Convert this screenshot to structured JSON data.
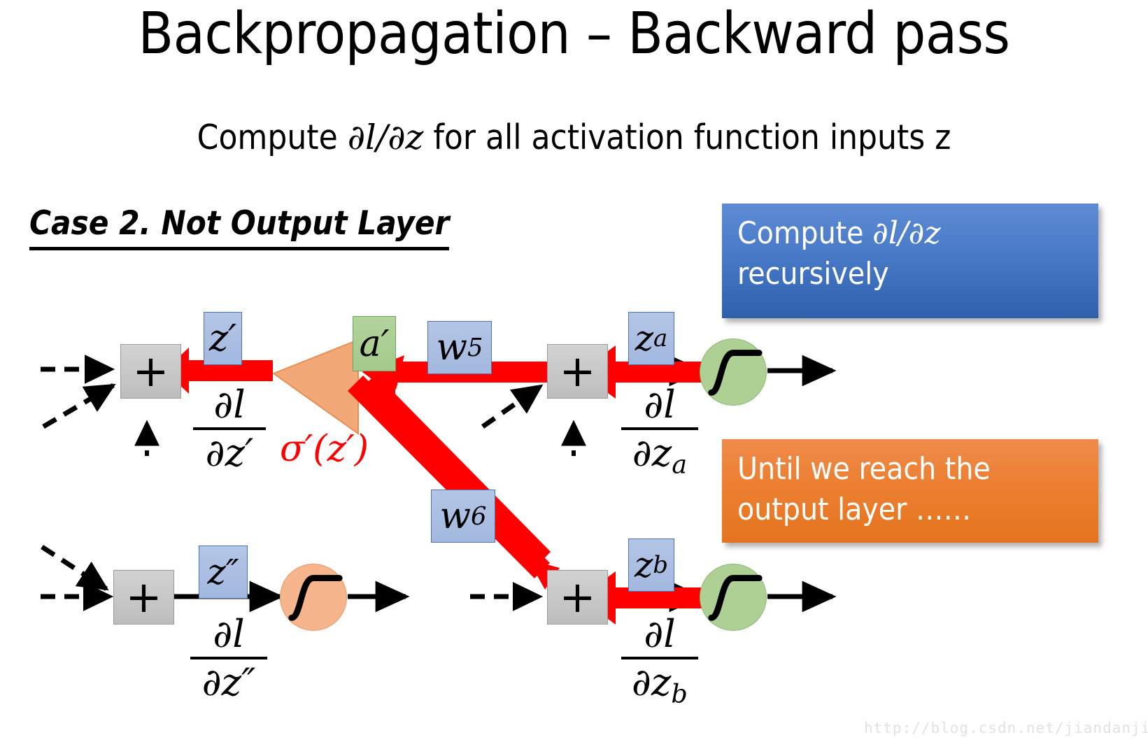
{
  "slide": {
    "title": "Backpropagation – Backward pass",
    "subtitle_pre": "Compute ",
    "subtitle_math": "∂l/∂z",
    "subtitle_post": " for all activation function inputs z",
    "case_heading": "Case 2. Not Output Layer",
    "watermark": "http://blog.csdn.net/jiandanjinxin"
  },
  "callouts": [
    {
      "id": "compute-recursively",
      "line1_pre": "Compute ",
      "line1_math": "∂l/∂z",
      "line2": "recursively",
      "color": "#2F60AC"
    },
    {
      "id": "until-output-layer",
      "line1": "Until we reach the",
      "line2": "output layer ……",
      "color": "#E4741F"
    }
  ],
  "diagram": {
    "nodes": [
      {
        "id": "plus-top-left",
        "label": "+"
      },
      {
        "id": "plus-top-right",
        "label": "+"
      },
      {
        "id": "plus-bottom-left",
        "label": "+"
      },
      {
        "id": "plus-bottom-right",
        "label": "+"
      }
    ],
    "activations": [
      {
        "id": "sigmoid-top-right",
        "color": "#AED095",
        "icon": "sigmoid-icon"
      },
      {
        "id": "sigmoid-bottom-left",
        "color": "#F6B58C",
        "icon": "sigmoid-icon"
      },
      {
        "id": "sigmoid-bottom-right",
        "color": "#AED095",
        "icon": "sigmoid-icon"
      }
    ],
    "var_labels": [
      {
        "id": "z-prime",
        "text": "z′",
        "color": "blue"
      },
      {
        "id": "a-prime",
        "text": "a′",
        "color": "green"
      },
      {
        "id": "w5",
        "base": "w",
        "sub": "5",
        "color": "blue"
      },
      {
        "id": "w6",
        "base": "w",
        "sub": "6",
        "color": "blue"
      },
      {
        "id": "z-a",
        "base": "z",
        "sub": "a",
        "color": "blue"
      },
      {
        "id": "z-b",
        "base": "z",
        "sub": "b",
        "color": "blue"
      },
      {
        "id": "z-double-prime",
        "text": "z″",
        "color": "blue"
      }
    ],
    "derivatives": [
      {
        "id": "dl-dz-prime",
        "num": "∂l",
        "den_base": "∂z",
        "den_sup": "′",
        "den_sub": ""
      },
      {
        "id": "dl-dz-a",
        "num": "∂l",
        "den_base": "∂z",
        "den_sup": "",
        "den_sub": "a"
      },
      {
        "id": "dl-dz-double-prime",
        "num": "∂l",
        "den_base": "∂z",
        "den_sup": "″",
        "den_sub": ""
      },
      {
        "id": "dl-dz-b",
        "num": "∂l",
        "den_base": "∂z",
        "den_sup": "",
        "den_sub": "b"
      }
    ],
    "sigma_label": {
      "id": "sigma-prime-z-prime",
      "text": "σ′(z′)",
      "color": "#FF0000"
    },
    "triangle": {
      "id": "derivative-triangle",
      "color": "#F3A878"
    },
    "arrow_colors": {
      "backward": "#FF0000",
      "forward": "#000000"
    }
  }
}
